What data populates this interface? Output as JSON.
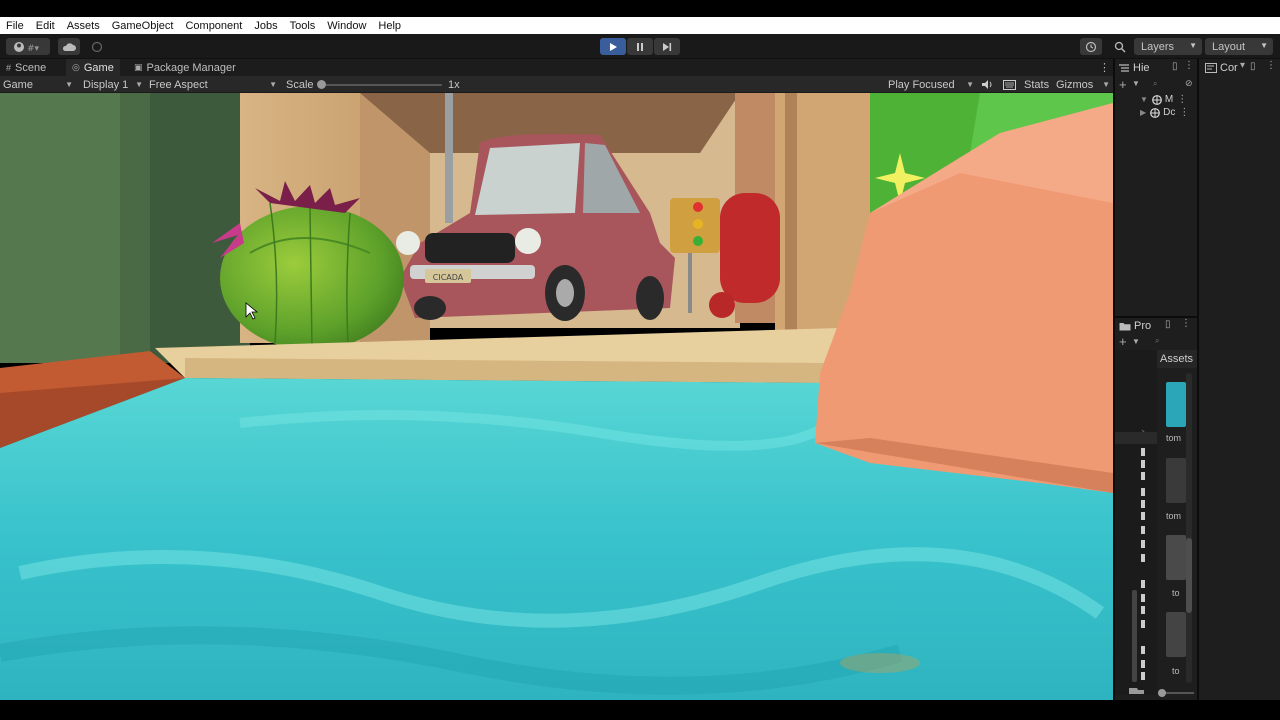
{
  "menu": [
    "File",
    "Edit",
    "Assets",
    "GameObject",
    "Component",
    "Jobs",
    "Tools",
    "Window",
    "Help"
  ],
  "toolbar": {
    "layers_label": "Layers",
    "layout_label": "Layout"
  },
  "tabs": {
    "scene": "Scene",
    "game": "Game",
    "package_manager": "Package Manager"
  },
  "gamebar": {
    "mode": "Game",
    "display": "Display 1",
    "aspect": "Free Aspect",
    "scale_label": "Scale",
    "scale_value": "1x",
    "play_focused": "Play Focused",
    "stats": "Stats",
    "gizmos": "Gizmos"
  },
  "scale_level": 0.0,
  "scene": {
    "license_plate": "CICADA"
  },
  "hierarchy": {
    "tab": "Hie",
    "items": [
      "M",
      "Dc"
    ]
  },
  "console": {
    "tab": "Cor"
  },
  "project": {
    "tab": "Pro",
    "assets_header": "Assets",
    "thumb_labels": [
      "tom",
      "tom",
      "to",
      "to"
    ]
  },
  "colors": {
    "play_button": "#3a5e9c",
    "editor_bg": "#282828",
    "water": "#3cc8cc"
  }
}
